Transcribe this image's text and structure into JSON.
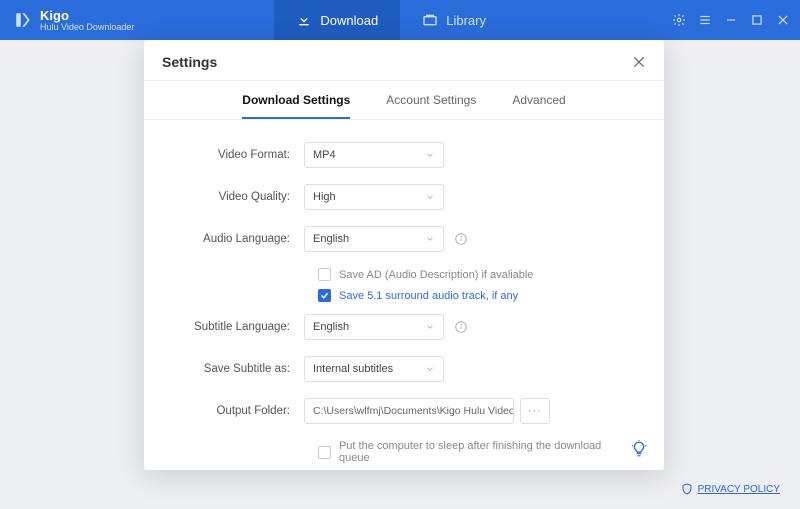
{
  "brand": {
    "title": "Kigo",
    "subtitle": "Hulu Video Downloader"
  },
  "nav": {
    "download": "Download",
    "library": "Library"
  },
  "modal": {
    "title": "Settings",
    "tabs": {
      "download": "Download Settings",
      "account": "Account Settings",
      "advanced": "Advanced"
    },
    "labels": {
      "video_format": "Video Format:",
      "video_quality": "Video Quality:",
      "audio_language": "Audio Language:",
      "subtitle_language": "Subtitle Language:",
      "save_subtitle_as": "Save Subtitle as:",
      "output_folder": "Output Folder:"
    },
    "values": {
      "video_format": "MP4",
      "video_quality": "High",
      "audio_language": "English",
      "subtitle_language": "English",
      "save_subtitle_as": "Internal subtitles",
      "output_folder": "C:\\Users\\wlfmj\\Documents\\Kigo Hulu Video Dc"
    },
    "checks": {
      "save_ad": "Save AD (Audio Description) if avaliable",
      "save_surround": "Save 5.1 surround audio track, if any",
      "sleep_after": "Put the computer to sleep after finishing the download queue"
    },
    "browse": "···"
  },
  "footer": {
    "privacy": "PRIVACY POLICY"
  }
}
